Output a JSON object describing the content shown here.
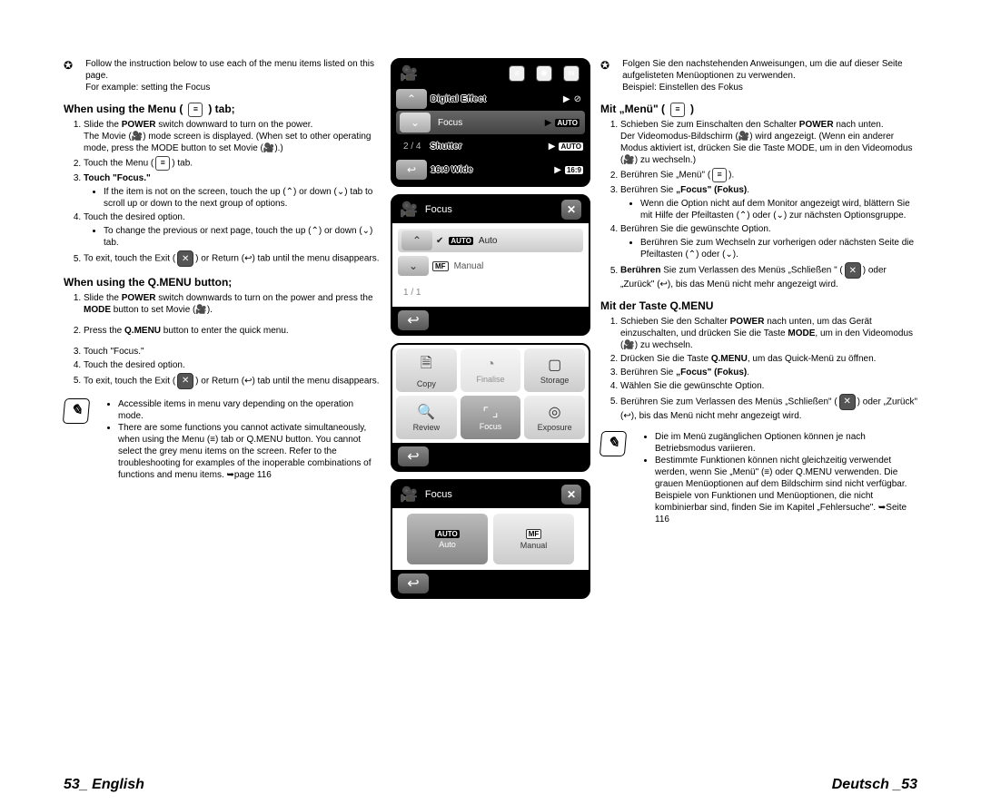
{
  "intro_en": {
    "line1": "Follow the instruction below to use each of the menu items listed on this page.",
    "line2": "For example: setting the Focus"
  },
  "section_a_en": {
    "title": "When using the Menu (",
    "title_after": ") tab;",
    "steps": [
      "Slide the POWER switch downward to turn on the power.",
      "Touch the Menu (",
      "Touch \"Focus.\"",
      "Touch the desired option.",
      "To exit, touch the Exit ("
    ],
    "step1_note": "The Movie (🎥) mode screen is displayed. (When set to other operating mode, press the MODE button to set Movie (🎥).)",
    "step2_tail": ") tab.",
    "step3_bullet": "If the item is not on the screen, touch the up (⌃) or down (⌄) tab to scroll up or down to the next group of options.",
    "step4_bullet": "To change the previous or next page, touch the up (⌃) or down (⌄) tab.",
    "step5_tail": ") or Return (↩) tab until the menu disappears."
  },
  "section_b_en": {
    "title": "When using the Q.MENU button;",
    "steps": [
      "Slide the POWER switch downwards to turn on the power and press the MODE button to set Movie (🎥).",
      "Press the Q.MENU button to enter the quick menu.",
      "Touch \"Focus.\"",
      "Touch the desired option.",
      "To exit, touch the Exit ("
    ],
    "step5_tail": ") or Return (↩) tab until the menu disappears."
  },
  "notes_en": [
    "Accessible items in menu vary depending on the operation mode.",
    "There are some functions you cannot activate simultaneously, when using the Menu (≡) tab or Q.MENU button. You cannot select the grey menu items on the screen. Refer to the troubleshooting for examples of the inoperable combinations of functions and menu items. ➥page 116"
  ],
  "intro_de": {
    "line1": "Folgen Sie den nachstehenden Anweisungen, um die auf dieser Seite aufgelisteten Menüoptionen zu verwenden.",
    "line2": "Beispiel: Einstellen des Fokus"
  },
  "section_a_de": {
    "title": "Mit „Menü\" (",
    "title_after": ")",
    "steps": [
      "Schieben Sie zum Einschalten den Schalter POWER nach unten.",
      "Berühren Sie „Menü\" (",
      "Berühren Sie „Focus\" (Fokus).",
      "Berühren Sie die gewünschte Option.",
      "Berühren Sie zum Verlassen des Menüs „Schließen\" ("
    ],
    "step1_note": "Der Videomodus-Bildschirm (🎥) wird angezeigt. (Wenn ein anderer Modus aktiviert ist, drücken Sie die Taste MODE, um in den Videomodus (🎥) zu wechseln.)",
    "step2_tail": ").",
    "step3_bullet": "Wenn die Option nicht auf dem Monitor angezeigt wird, blättern Sie mit Hilfe der Pfeiltasten (⌃) oder (⌄) zur nächsten Optionsgruppe.",
    "step4_bullet": "Berühren Sie zum Wechseln zur vorherigen oder nächsten Seite die Pfeiltasten (⌃) oder (⌄).",
    "step5_tail": ") oder „Zurück\" (↩), bis das Menü nicht mehr angezeigt wird."
  },
  "section_b_de": {
    "title": "Mit der Taste Q.MENU",
    "steps": [
      "Schieben Sie den Schalter POWER nach unten, um das Gerät einzuschalten, und drücken Sie die Taste MODE, um in den Videomodus (🎥) zu wechseln.",
      "Drücken Sie die Taste Q.MENU, um das Quick-Menü zu öffnen.",
      "Berühren Sie „Focus\" (Fokus).",
      "Wählen Sie die gewünschte Option.",
      "Berühren Sie zum Verlassen des Menüs „Schließen\" ("
    ],
    "step5_tail": ") oder „Zurück\" (↩), bis das Menü nicht mehr angezeigt wird."
  },
  "notes_de": [
    "Die im Menü zugänglichen Optionen können je nach Betriebsmodus variieren.",
    "Bestimmte Funktionen können nicht gleichzeitig verwendet werden, wenn Sie „Menü\" (≡) oder Q.MENU verwenden. Die grauen Menüoptionen auf dem Bildschirm sind nicht verfügbar. Beispiele von Funktionen und Menüoptionen, die nicht kombinierbar sind, finden Sie im Kapitel „Fehlersuche\". ➥Seite 116"
  ],
  "ui1": {
    "items": [
      {
        "label": "Digital Effect",
        "icon_r": "⊘"
      },
      {
        "label": "Focus",
        "icon_r": "AUTO",
        "selected": true
      },
      {
        "label": "Shutter",
        "icon_r": "AUTO"
      },
      {
        "label": "16:9 Wide",
        "icon_r": "16:9"
      }
    ],
    "counter": "2 / 4"
  },
  "ui2": {
    "title": "Focus",
    "items": [
      {
        "badge": "AUTO",
        "label": "Auto",
        "selected": true
      },
      {
        "badge": "MF",
        "label": "Manual"
      }
    ],
    "counter": "1 / 1"
  },
  "ui3": {
    "items": [
      {
        "label": "Copy",
        "icon": "📄"
      },
      {
        "label": "Finalise",
        "icon": "💿",
        "dim": true
      },
      {
        "label": "Storage",
        "icon": "▢"
      },
      {
        "label": "Review",
        "icon": "🔍"
      },
      {
        "label": "Focus",
        "icon": "[ ]",
        "selected": true
      },
      {
        "label": "Exposure",
        "icon": "◎"
      }
    ]
  },
  "ui4": {
    "title": "Focus",
    "items": [
      {
        "badge": "AUTO",
        "label": "Auto",
        "selected": true
      },
      {
        "badge": "MF",
        "label": "Manual"
      }
    ]
  },
  "footer": {
    "left": "53_ English",
    "right": "Deutsch _53"
  }
}
